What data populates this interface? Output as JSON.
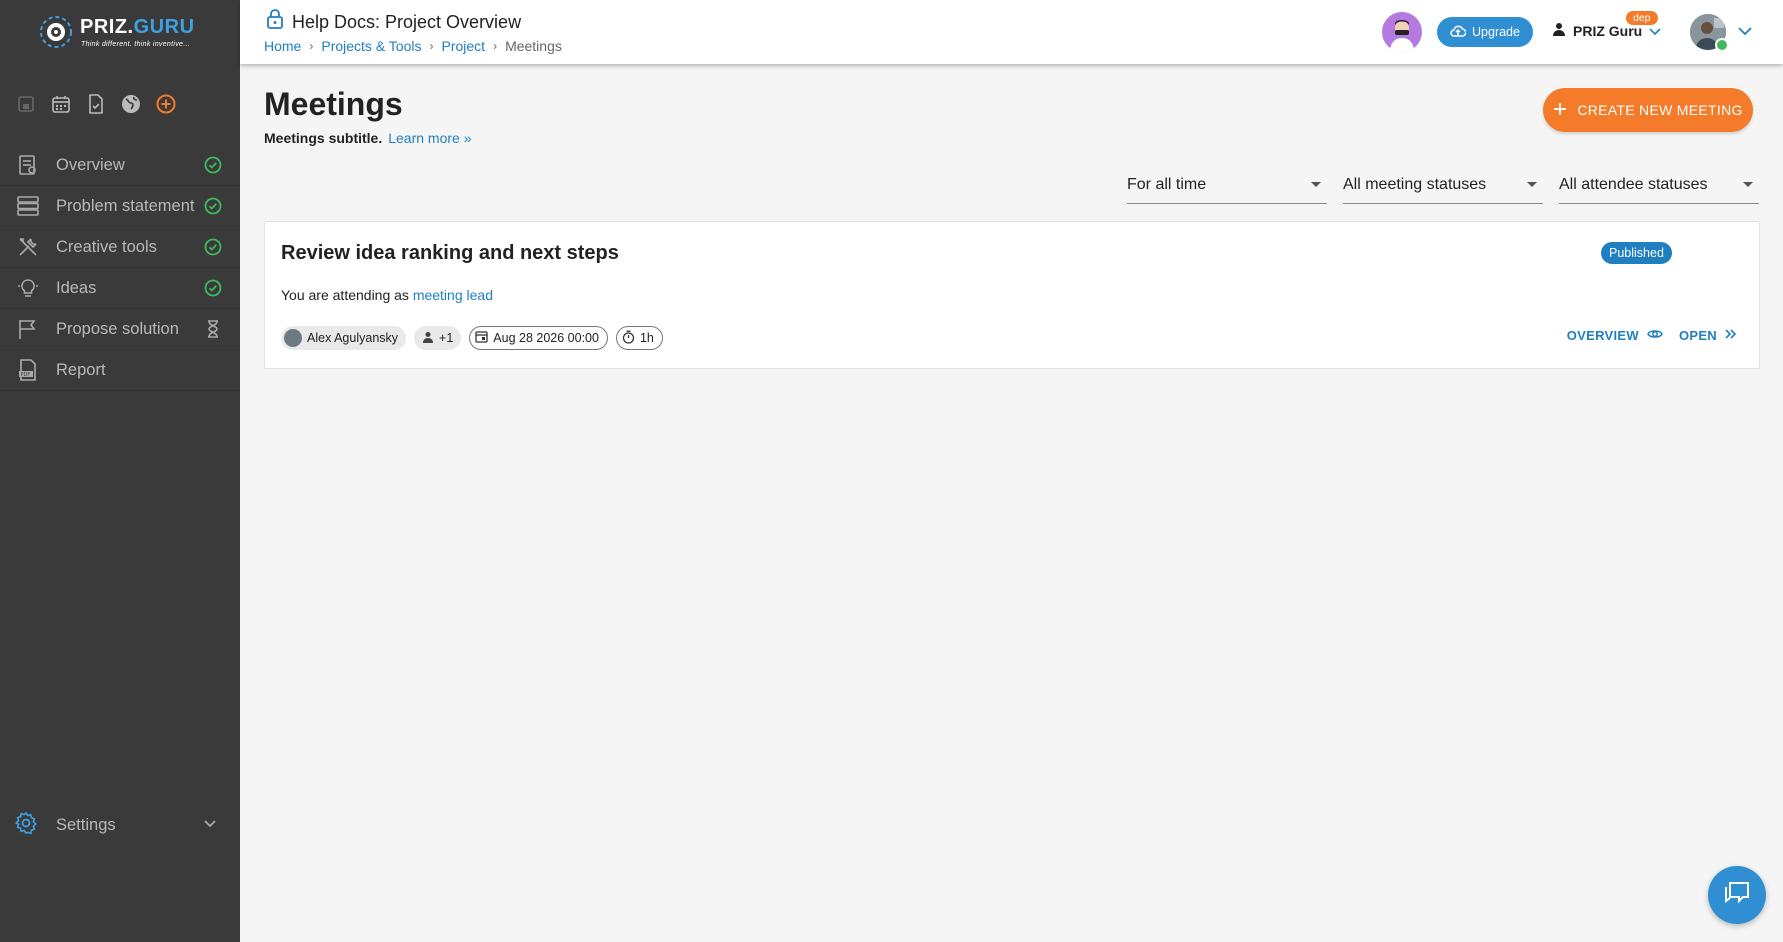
{
  "app": {
    "logo_text_a": "PRIZ.",
    "logo_text_b": "GURU",
    "logo_tagline": "Think different. think inventive..."
  },
  "header": {
    "project_title": "Help Docs: Project Overview",
    "breadcrumb": [
      "Home",
      "Projects & Tools",
      "Project",
      "Meetings"
    ],
    "upgrade_label": "Upgrade",
    "user_name": "PRIZ Guru",
    "env_badge": "dep"
  },
  "sidebar": {
    "quick_icons": [
      "save-icon",
      "calendar-icon",
      "task-icon",
      "globe-icon",
      "add-circle-icon"
    ],
    "items": [
      {
        "label": "Overview",
        "icon": "overview-icon",
        "status": "done"
      },
      {
        "label": "Problem statement",
        "icon": "problem-statement-icon",
        "status": "done"
      },
      {
        "label": "Creative tools",
        "icon": "tools-icon",
        "status": "done"
      },
      {
        "label": "Ideas",
        "icon": "lightbulb-icon",
        "status": "done"
      },
      {
        "label": "Propose solution",
        "icon": "flag-icon",
        "status": "pending"
      },
      {
        "label": "Report",
        "icon": "pdf-icon",
        "status": "none"
      }
    ],
    "settings_label": "Settings"
  },
  "main": {
    "title": "Meetings",
    "subtitle": "Meetings subtitle.",
    "learn_more": "Learn more »",
    "create_button": "CREATE NEW MEETING",
    "filters": {
      "period": "For all time",
      "meeting_status": "All meeting statuses",
      "attendee_status": "All attendee statuses"
    },
    "meetings": [
      {
        "title": "Review idea ranking and next steps",
        "status": "Published",
        "attending_prefix": "You are attending as",
        "role": "meeting lead",
        "owner": "Alex Agulyansky",
        "attendees_extra": "+1",
        "date": "Aug 28 2026 00:00",
        "duration": "1h",
        "overview_label": "OVERVIEW",
        "open_label": "OPEN"
      }
    ]
  },
  "colors": {
    "accent_orange": "#f47b2a",
    "link_blue": "#1f7fc1",
    "sidebar_bg": "#3a3a3a",
    "status_green": "#3eba5d"
  }
}
